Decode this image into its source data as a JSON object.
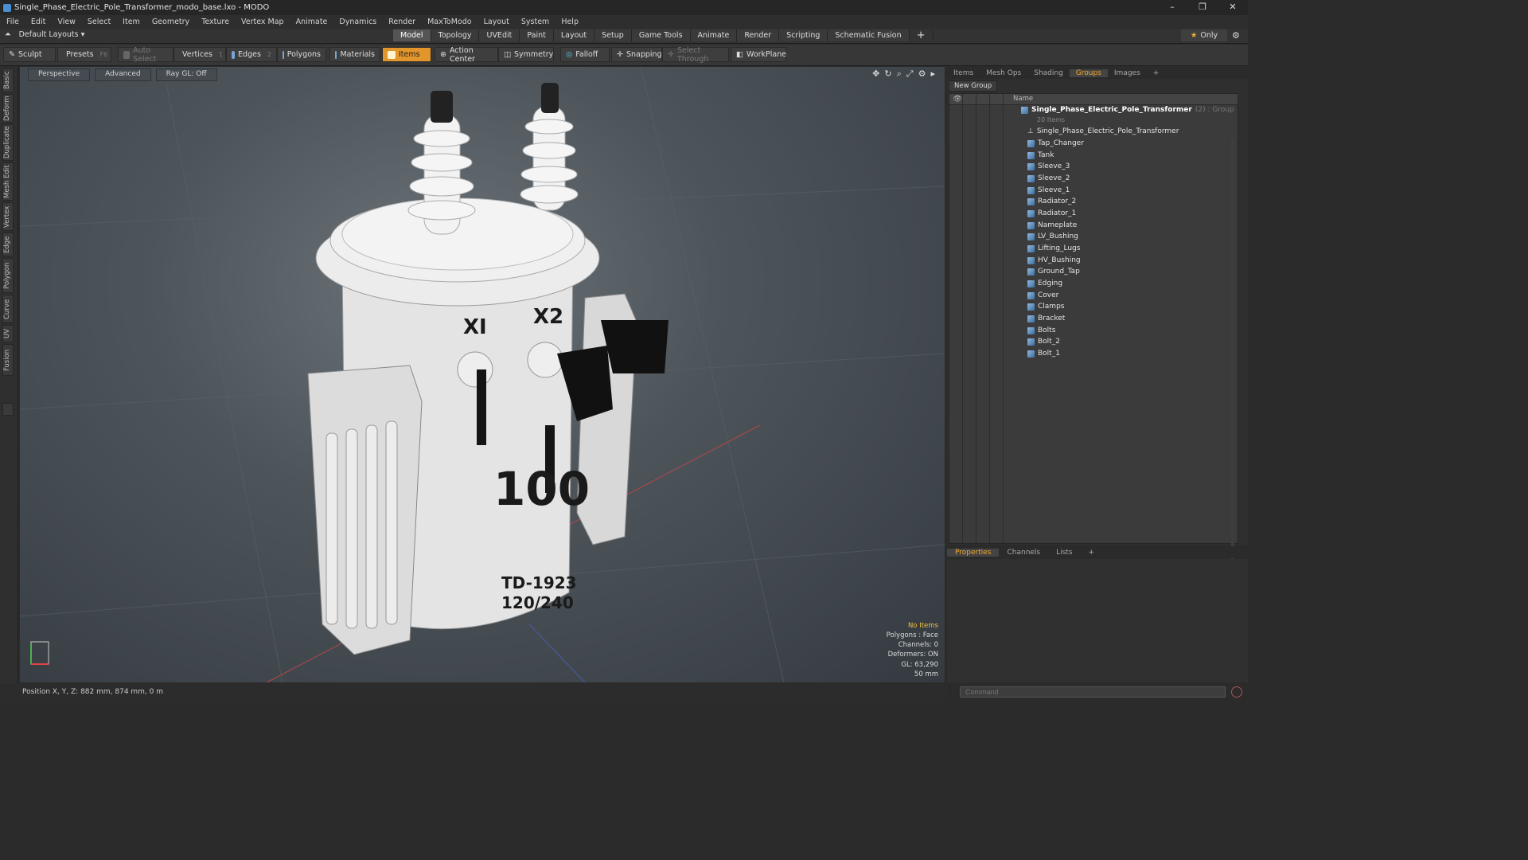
{
  "window": {
    "title": "Single_Phase_Electric_Pole_Transformer_modo_base.lxo - MODO",
    "controls": [
      "–",
      "❐",
      "✕"
    ]
  },
  "menu": [
    "File",
    "Edit",
    "View",
    "Select",
    "Item",
    "Geometry",
    "Texture",
    "Vertex Map",
    "Animate",
    "Dynamics",
    "Render",
    "MaxToModo",
    "Layout",
    "System",
    "Help"
  ],
  "layout": {
    "dropdown": "Default Layouts ▾",
    "tabs": [
      "Model",
      "Topology",
      "UVEdit",
      "Paint",
      "Layout",
      "Setup",
      "Game Tools",
      "Animate",
      "Render",
      "Scripting",
      "Schematic Fusion"
    ],
    "active_tab": "Model",
    "add_tab": "+",
    "only_label": "Only"
  },
  "toolbar": {
    "sculpt": "Sculpt",
    "presets": "Presets",
    "presets_key": "F6",
    "auto_select": "Auto Select",
    "vertices": "Vertices",
    "vertices_key": "1",
    "edges": "Edges",
    "edges_key": "2",
    "polygons": "Polygons",
    "materials": "Materials",
    "items": "Items",
    "action_center": "Action Center",
    "symmetry": "Symmetry",
    "falloff": "Falloff",
    "snapping": "Snapping",
    "select_through": "Select Through",
    "workplane": "WorkPlane"
  },
  "left_tabs": [
    "Basic",
    "Deform",
    "Duplicate",
    "Mesh Edit",
    "Vertex",
    "Edge",
    "Polygon",
    "Curve",
    "UV",
    "Fusion"
  ],
  "viewport": {
    "view_mode": "Perspective",
    "shading": "Advanced",
    "raygl": "Ray GL: Off",
    "model_text": {
      "x1": "XI",
      "x2": "X2",
      "rating": "100",
      "code": "TD-1923",
      "volts": "120/240"
    },
    "info": {
      "selection": "No Items",
      "polygons": "Polygons : Face",
      "channels": "Channels: 0",
      "deformers": "Deformers: ON",
      "gl": "GL: 63,290",
      "scale": "50 mm"
    }
  },
  "status": {
    "position": "Position X, Y, Z:   882 mm, 874 mm, 0 m"
  },
  "right_panel": {
    "tabs": [
      "Items",
      "Mesh Ops",
      "Shading",
      "Groups",
      "Images"
    ],
    "active_tab": "Groups",
    "add_tab": "+",
    "new_group": "New Group",
    "column_name": "Name",
    "group": {
      "name": "Single_Phase_Electric_Pole_Transformer",
      "meta": "(2) : Group",
      "count": "20 Items"
    },
    "items": [
      "Single_Phase_Electric_Pole_Transformer",
      "Tap_Changer",
      "Tank",
      "Sleeve_3",
      "Sleeve_2",
      "Sleeve_1",
      "Radiator_2",
      "Radiator_1",
      "Nameplate",
      "LV_Bushing",
      "Lifting_Lugs",
      "HV_Bushing",
      "Ground_Tap",
      "Edging",
      "Cover",
      "Clamps",
      "Bracket",
      "Bolts",
      "Bolt_2",
      "Bolt_1"
    ]
  },
  "bottom_panel": {
    "tabs": [
      "Properties",
      "Channels",
      "Lists"
    ],
    "active_tab": "Properties",
    "add_tab": "+"
  },
  "command": {
    "placeholder": "Command"
  },
  "colors": {
    "accent": "#f0a630",
    "items_active": "#e2952a",
    "highlight_text": "#f0c040"
  }
}
